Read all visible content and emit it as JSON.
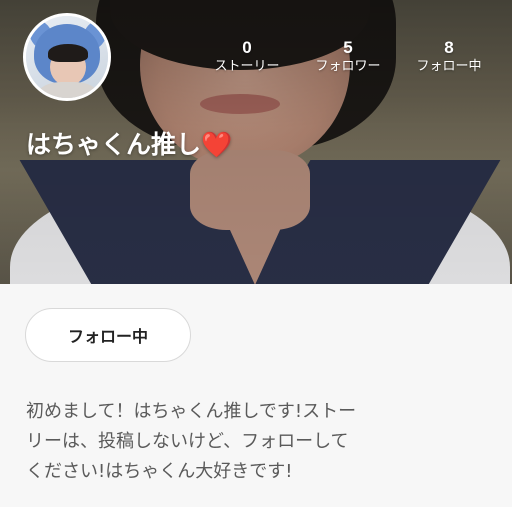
{
  "profile": {
    "username": "はちゃくん推し",
    "username_emoji": "❤️",
    "stats": [
      {
        "value": "0",
        "label": "ストーリー"
      },
      {
        "value": "5",
        "label": "フォロワー"
      },
      {
        "value": "8",
        "label": "フォロー中"
      }
    ],
    "follow_button_label": "フォロー中",
    "bio": "初めまして！はちゃくん推しです!ストー\nリーは、投稿しないけど、フォローして\nください!はちゃくん大好きです!"
  },
  "colors": {
    "page_background": "#f7f7f7",
    "overlay_text": "#ffffff",
    "bio_text": "#5a5a5a",
    "heart": "#e5262e"
  }
}
